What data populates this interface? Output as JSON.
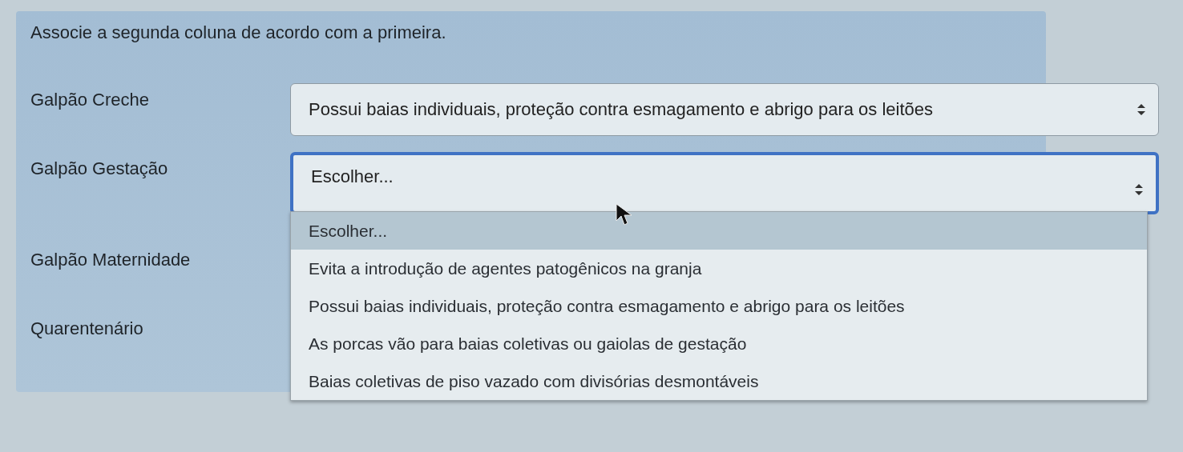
{
  "question": "Associe a segunda coluna de acordo com a primeira.",
  "rows": [
    {
      "label": "Galpão Creche",
      "select": {
        "value": "Possui baias individuais, proteção contra esmagamento e abrigo para os leitões",
        "focused": false
      }
    },
    {
      "label": "Galpão Gestação",
      "select": {
        "value": "Escolher...",
        "focused": true
      }
    },
    {
      "label": "Galpão Maternidade"
    },
    {
      "label": "Quarentenário"
    }
  ],
  "dropdown": {
    "options": [
      {
        "label": "Escolher...",
        "selected": true
      },
      {
        "label": "Evita a introdução de agentes patogênicos na granja",
        "selected": false
      },
      {
        "label": "Possui baias individuais, proteção contra esmagamento e abrigo para os leitões",
        "selected": false
      },
      {
        "label": "As porcas vão para baias coletivas ou gaiolas de gestação",
        "selected": false
      },
      {
        "label": "Baias coletivas de piso vazado com divisórias desmontáveis",
        "selected": false
      }
    ]
  }
}
